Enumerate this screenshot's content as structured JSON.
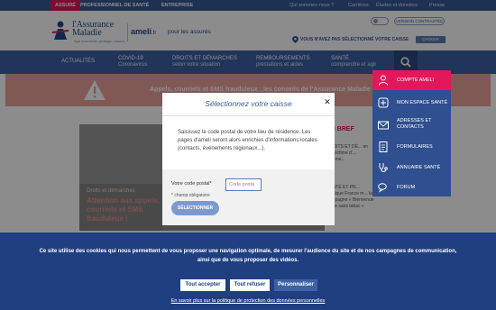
{
  "topbar": {
    "tabs": [
      "ASSURÉ",
      "PROFESSIONNEL DE SANTÉ",
      "ENTREPRISE"
    ],
    "links": [
      "Qui sommes-nous ?",
      "Carrières",
      "Études et données",
      "Presse"
    ]
  },
  "header": {
    "logo_line1": "l'Assurance",
    "logo_line2": "Maladie",
    "logo_sub": "Agir ensemble, protéger chacun",
    "ameli": "ameli",
    "ameli_suffix": ".fr",
    "pour": "pour les assurés",
    "version_btn": "VERSION CONTRASTÉE",
    "caisse_text": "VOUS N'AVEZ PAS SÉLECTIONNÉ VOTRE CAISSE",
    "choisir_btn": "CHOISIR"
  },
  "nav": {
    "items": [
      {
        "label": "ACTUALITÉS",
        "sub": ""
      },
      {
        "label": "COVID-19",
        "sub": "Coronavirus"
      },
      {
        "label": "DROITS ET DÉMARCHES",
        "sub": "selon votre situation"
      },
      {
        "label": "REMBOURSEMENTS",
        "sub": "prestations et aides"
      },
      {
        "label": "SANTÉ",
        "sub": "comprendre et agir"
      }
    ]
  },
  "alert": {
    "text": "Appels, courriels et SMS frauduleux : les conseils de l'Assurance Maladie pour"
  },
  "sidemenu": {
    "items": [
      "COMPTE AMELI",
      "MON ESPACE SANTÉ",
      "ADRESSES ET CONTACTS",
      "FORMULAIRES",
      "ANNUAIRE SANTÉ",
      "FORUM"
    ]
  },
  "article": {
    "category": "Droits et démarches",
    "title": "Attention aux appels, courriels et SMS frauduleux !"
  },
  "bref": {
    "title": "EN BREF",
    "item1": "DROITS ET DÉ... on est victime d'... comme...",
    "item2": "SANTÉ ET PR... publique France m... la campagne « Bienvenue ... vie sans tabac »"
  },
  "modal": {
    "title": "Sélectionnez votre caisse",
    "description": "Saisissez le code postal de votre lieu de résidence. Les pages d'ameli seront alors enrichies d'informations locales (contacts, événements régionaux...).",
    "cp_label": "Votre code postal*",
    "cp_placeholder": "Code posta",
    "required_note": "* champ obligatoire",
    "select_btn": "SÉLECTIONNER"
  },
  "cookie": {
    "text": "Ce site utilise des cookies qui nous permettent de vous proposer une navigation optimale, de mesurer l'audience du site et de nos campagnes de communication, ainsi que de vous proposer des vidéos.",
    "accept": "Tout accepter",
    "refuse": "Tout refuser",
    "personalize": "Personnaliser",
    "link": "En savoir plus sur la politique de protection des données personnelles"
  },
  "colors": {
    "brand_blue": "#3d61a4",
    "accent_pink": "#e2185b",
    "alert_bg": "#e9a29b"
  }
}
